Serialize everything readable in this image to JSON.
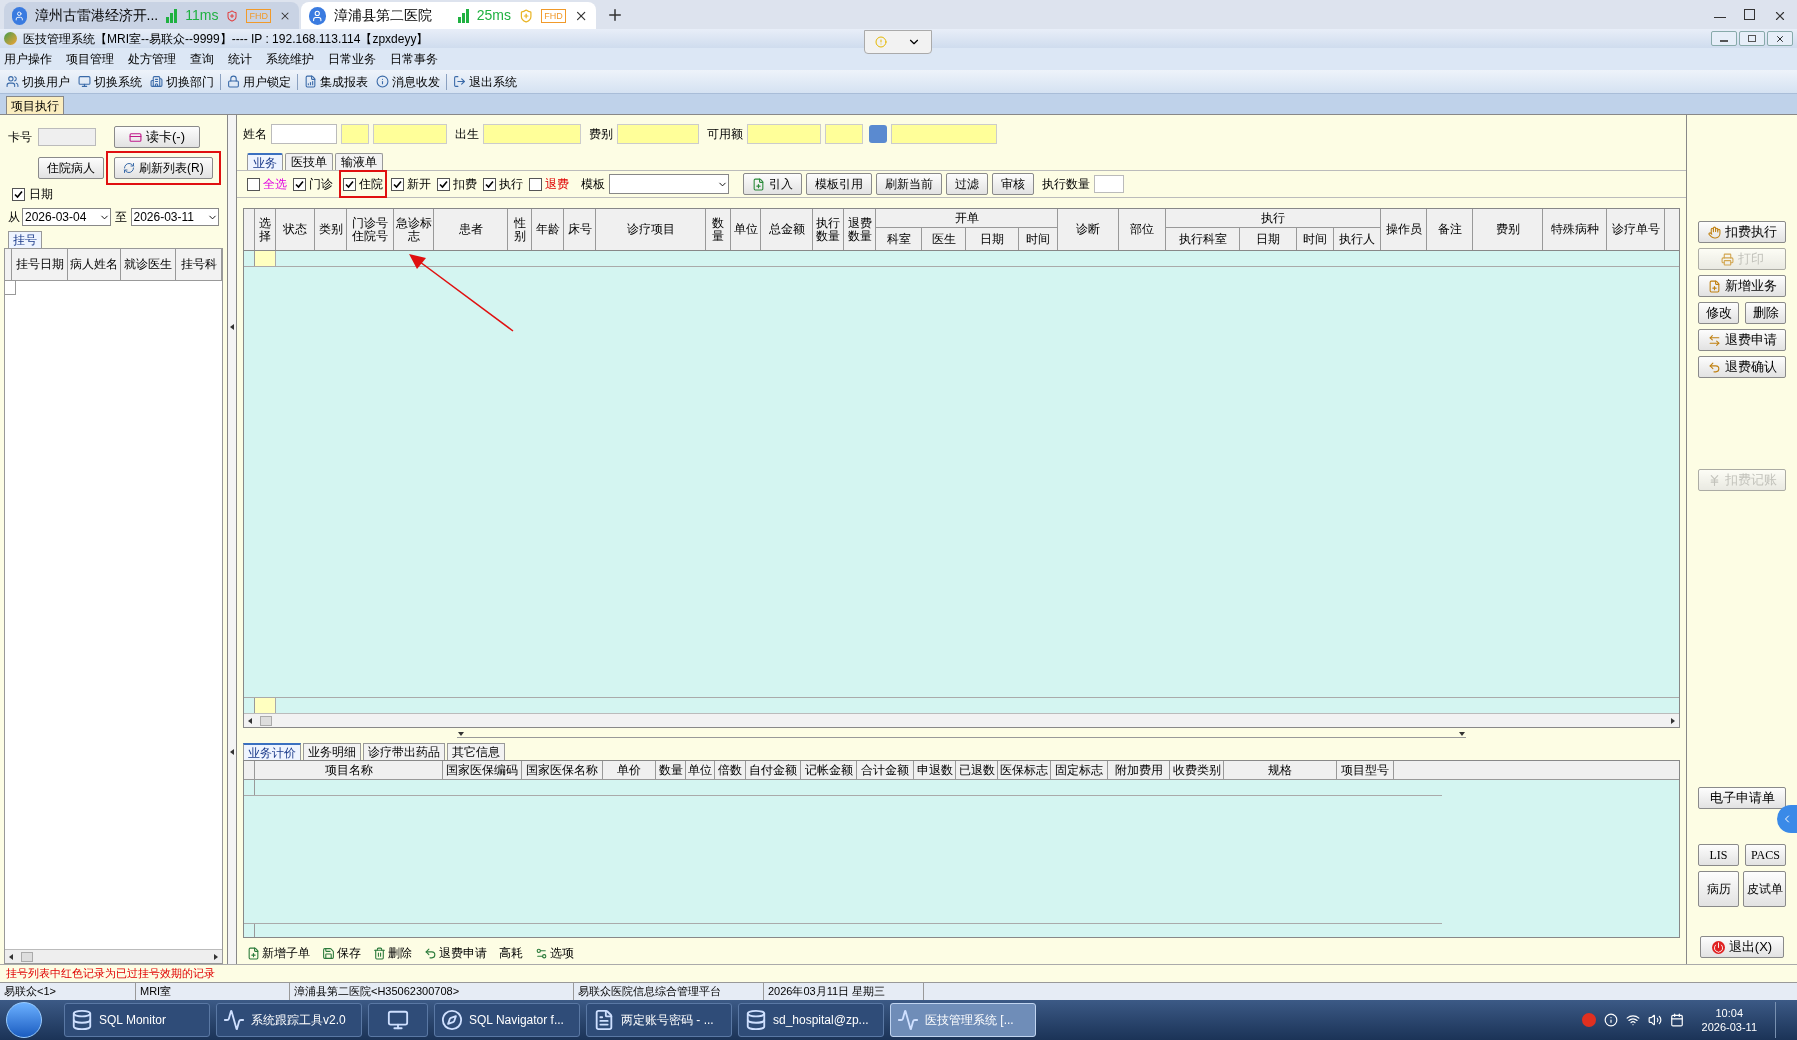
{
  "browser_tabs": [
    {
      "title": "漳州古雷港经济开...",
      "ping": "11ms",
      "badge": "FHD",
      "selected": false
    },
    {
      "title": "漳浦县第二医院",
      "ping": "25ms",
      "badge": "FHD",
      "selected": true
    }
  ],
  "window": {
    "title": "医技管理系统【MRI室--易联众--9999】---- IP : 192.168.113.114【zpxdeyy】"
  },
  "menu": [
    "用户操作",
    "项目管理",
    "处方管理",
    "查询",
    "统计",
    "系统维护",
    "日常业务",
    "日常事务"
  ],
  "toolbar": [
    {
      "label": "切换用户",
      "separator_after": false
    },
    {
      "label": "切换系统",
      "separator_after": false
    },
    {
      "label": "切换部门",
      "separator_after": true
    },
    {
      "label": "用户锁定",
      "separator_after": true
    },
    {
      "label": "集成报表",
      "separator_after": false
    },
    {
      "label": "消息收发",
      "separator_after": true
    },
    {
      "label": "退出系统",
      "separator_after": false
    }
  ],
  "doc_tab": "项目执行",
  "left": {
    "card_label": "卡号",
    "read_card": "读卡(-)",
    "inpatient": "住院病人",
    "refresh": "刷新列表(R)",
    "date_check": {
      "label": "日期",
      "checked": true
    },
    "from_label": "从",
    "from": "2026-03-04",
    "to_label": "至",
    "to": "2026-03-11",
    "tab": "挂号",
    "columns": [
      "挂号日期",
      "病人姓名",
      "就诊医生",
      "挂号科"
    ],
    "note": "挂号列表中红色记录为已过挂号效期的记录"
  },
  "patient_form": [
    "姓名",
    "出生",
    "费别",
    "可用额"
  ],
  "tabs": [
    {
      "label": "业务",
      "selected": true
    },
    {
      "label": "医技单",
      "selected": false
    },
    {
      "label": "输液单",
      "selected": false
    }
  ],
  "filters": [
    {
      "label": "全选",
      "checked": false,
      "kind": "select_all"
    },
    {
      "label": "门诊",
      "checked": true,
      "kind": "normal"
    },
    {
      "label": "住院",
      "checked": true,
      "kind": "normal"
    },
    {
      "label": "新开",
      "checked": true,
      "kind": "normal"
    },
    {
      "label": "扣费",
      "checked": true,
      "kind": "normal"
    },
    {
      "label": "执行",
      "checked": true,
      "kind": "normal"
    },
    {
      "label": "退费",
      "checked": false,
      "kind": "refund"
    }
  ],
  "template_label": "模板",
  "filter_buttons": [
    "引入",
    "模板引用",
    "刷新当前",
    "过滤",
    "审核"
  ],
  "exec_qty_label": "执行数量",
  "table": {
    "columns": [
      {
        "label": "选择"
      },
      {
        "label": "状态"
      },
      {
        "label": "类别"
      },
      {
        "label": "门诊号住院号"
      },
      {
        "label": "急诊标志"
      },
      {
        "label": "患者"
      },
      {
        "label": "性别"
      },
      {
        "label": "年龄"
      },
      {
        "label": "床号"
      },
      {
        "label": "诊疗项目"
      },
      {
        "label": "数量"
      },
      {
        "label": "单位"
      },
      {
        "label": "总金额"
      },
      {
        "label": "执行数量"
      },
      {
        "label": "退费数量"
      },
      {
        "label": "开单",
        "children": [
          "科室",
          "医生",
          "日期",
          "时间"
        ]
      },
      {
        "label": "诊断"
      },
      {
        "label": "部位"
      },
      {
        "label": "执行",
        "children": [
          "执行科室",
          "日期",
          "时间",
          "执行人"
        ]
      },
      {
        "label": "操作员"
      },
      {
        "label": "备注"
      },
      {
        "label": "费别"
      },
      {
        "label": "特殊病种"
      },
      {
        "label": "诊疗单号"
      }
    ]
  },
  "detail_tabs": [
    {
      "label": "业务计价",
      "selected": true
    },
    {
      "label": "业务明细",
      "selected": false
    },
    {
      "label": "诊疗带出药品",
      "selected": false
    },
    {
      "label": "其它信息",
      "selected": false
    }
  ],
  "detail_columns": [
    "项目名称",
    "国家医保编码",
    "国家医保名称",
    "单价",
    "数量",
    "单位",
    "倍数",
    "自付金额",
    "记帐金额",
    "合计金额",
    "申退数",
    "已退数",
    "医保标志",
    "固定标志",
    "附加费用",
    "收费类别",
    "规格",
    "项目型号"
  ],
  "detail_toolbar": [
    "新增子单",
    "保存",
    "删除",
    "退费申请",
    "高耗",
    "选项"
  ],
  "side_buttons": [
    {
      "label": "扣费执行",
      "kind": "wide",
      "disabled": false
    },
    {
      "label": "打印",
      "kind": "wide",
      "disabled": true
    },
    {
      "label": "新增业务",
      "kind": "wide",
      "disabled": false
    },
    {
      "label": "修改",
      "kind": "half",
      "disabled": false
    },
    {
      "label": "删除",
      "kind": "half",
      "disabled": false
    },
    {
      "label": "退费申请",
      "kind": "wide",
      "disabled": false
    },
    {
      "label": "退费确认",
      "kind": "wide",
      "disabled": false
    }
  ],
  "side_account": {
    "label": "扣费记账",
    "disabled": true
  },
  "side_bottom": {
    "e_request": "电子申请单",
    "lis": "LIS",
    "pacs": "PACS",
    "record": "病历",
    "skin_test": "皮试单",
    "exit": "退出(X)"
  },
  "status_bar": [
    "易联众<1>",
    "MRI室",
    "漳浦县第二医院<H35062300708>",
    "易联众医院信息综合管理平台",
    "2026年03月11日 星期三"
  ],
  "taskbar": [
    {
      "label": "SQL Monitor",
      "selected": false
    },
    {
      "label": "系统跟踪工具v2.0",
      "selected": false
    },
    {
      "selected": false
    },
    {
      "label": "SQL Navigator f...",
      "selected": false
    },
    {
      "label": "两定账号密码 - ...",
      "selected": false
    },
    {
      "label": "sd_hospital@zp...",
      "selected": false
    },
    {
      "label": "医技管理系统 [...",
      "selected": true
    }
  ],
  "clock": {
    "time": "10:04",
    "date": "2026-03-11"
  }
}
